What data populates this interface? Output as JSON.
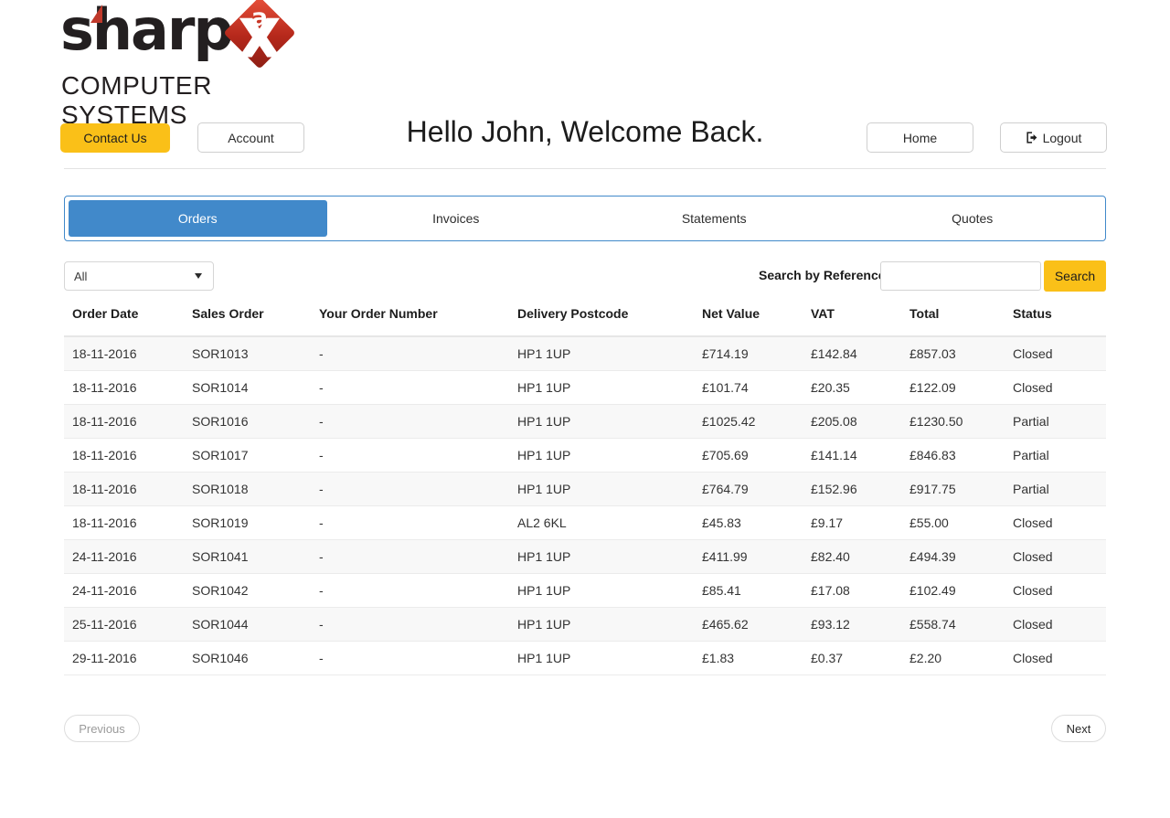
{
  "brand": {
    "wordmark": "sharp",
    "badge_letter_a": "a",
    "badge_letter_x": "X",
    "subtitle": "COMPUTER SYSTEMS",
    "accent_red": "#b5281b",
    "accent_yellow": "#fac018",
    "accent_blue": "#4189ca"
  },
  "header": {
    "contact_us_label": "Contact Us",
    "account_label": "Account",
    "welcome_text": "Hello John, Welcome Back.",
    "home_label": "Home",
    "logout_label": "Logout",
    "logout_icon": "sign-out-icon"
  },
  "tabs": [
    {
      "label": "Orders",
      "active": true
    },
    {
      "label": "Invoices",
      "active": false
    },
    {
      "label": "Statements",
      "active": false
    },
    {
      "label": "Quotes",
      "active": false
    }
  ],
  "filter": {
    "selected": "All",
    "caret_icon": "chevron-down-icon"
  },
  "search": {
    "label": "Search by Reference:",
    "value": "",
    "placeholder": "",
    "button_label": "Search"
  },
  "table": {
    "columns": [
      "Order Date",
      "Sales Order",
      "Your Order Number",
      "Delivery Postcode",
      "Net Value",
      "VAT",
      "Total",
      "Status"
    ],
    "rows": [
      {
        "order_date": "18-11-2016",
        "sales_order": "SOR1013",
        "your_order_number": "-",
        "delivery_postcode": "HP1 1UP",
        "net_value": "£714.19",
        "vat": "£142.84",
        "total": "£857.03",
        "status": "Closed"
      },
      {
        "order_date": "18-11-2016",
        "sales_order": "SOR1014",
        "your_order_number": "-",
        "delivery_postcode": "HP1 1UP",
        "net_value": "£101.74",
        "vat": "£20.35",
        "total": "£122.09",
        "status": "Closed"
      },
      {
        "order_date": "18-11-2016",
        "sales_order": "SOR1016",
        "your_order_number": "-",
        "delivery_postcode": "HP1 1UP",
        "net_value": "£1025.42",
        "vat": "£205.08",
        "total": "£1230.50",
        "status": "Partial"
      },
      {
        "order_date": "18-11-2016",
        "sales_order": "SOR1017",
        "your_order_number": "-",
        "delivery_postcode": "HP1 1UP",
        "net_value": "£705.69",
        "vat": "£141.14",
        "total": "£846.83",
        "status": "Partial"
      },
      {
        "order_date": "18-11-2016",
        "sales_order": "SOR1018",
        "your_order_number": "-",
        "delivery_postcode": "HP1 1UP",
        "net_value": "£764.79",
        "vat": "£152.96",
        "total": "£917.75",
        "status": "Partial"
      },
      {
        "order_date": "18-11-2016",
        "sales_order": "SOR1019",
        "your_order_number": "-",
        "delivery_postcode": "AL2 6KL",
        "net_value": "£45.83",
        "vat": "£9.17",
        "total": "£55.00",
        "status": "Closed"
      },
      {
        "order_date": "24-11-2016",
        "sales_order": "SOR1041",
        "your_order_number": "-",
        "delivery_postcode": "HP1 1UP",
        "net_value": "£411.99",
        "vat": "£82.40",
        "total": "£494.39",
        "status": "Closed"
      },
      {
        "order_date": "24-11-2016",
        "sales_order": "SOR1042",
        "your_order_number": "-",
        "delivery_postcode": "HP1 1UP",
        "net_value": "£85.41",
        "vat": "£17.08",
        "total": "£102.49",
        "status": "Closed"
      },
      {
        "order_date": "25-11-2016",
        "sales_order": "SOR1044",
        "your_order_number": "-",
        "delivery_postcode": "HP1 1UP",
        "net_value": "£465.62",
        "vat": "£93.12",
        "total": "£558.74",
        "status": "Closed"
      },
      {
        "order_date": "29-11-2016",
        "sales_order": "SOR1046",
        "your_order_number": "-",
        "delivery_postcode": "HP1 1UP",
        "net_value": "£1.83",
        "vat": "£0.37",
        "total": "£2.20",
        "status": "Closed"
      }
    ]
  },
  "pager": {
    "previous_label": "Previous",
    "next_label": "Next"
  }
}
